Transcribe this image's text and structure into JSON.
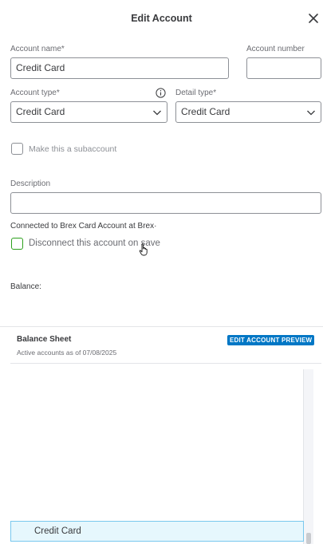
{
  "dialog": {
    "title": "Edit Account"
  },
  "form": {
    "account_name_label": "Account name*",
    "account_name_value": "Credit Card",
    "account_number_label": "Account number",
    "account_number_value": "",
    "account_type_label": "Account type*",
    "account_type_value": "Credit Card",
    "detail_type_label": "Detail type*",
    "detail_type_value": "Credit Card",
    "subaccount_label": "Make this a subaccount",
    "description_label": "Description",
    "description_value": "",
    "connected_text": "Connected to Brex Card Account at Brex·",
    "disconnect_label": "Disconnect this account on save",
    "balance_label": "Balance:"
  },
  "preview": {
    "title": "Balance Sheet",
    "subtitle": "Active accounts as of 07/08/2025",
    "badge": "EDIT ACCOUNT PREVIEW",
    "highlighted_row": "Credit Card"
  },
  "icons": {
    "close": "close-icon",
    "info": "info-icon",
    "chevron": "chevron-down-icon",
    "cursor": "hand-pointer-icon"
  },
  "colors": {
    "accent": "#0077c5",
    "checkbox_green": "#2ca01c",
    "highlight_bg": "#e6f7fd"
  }
}
